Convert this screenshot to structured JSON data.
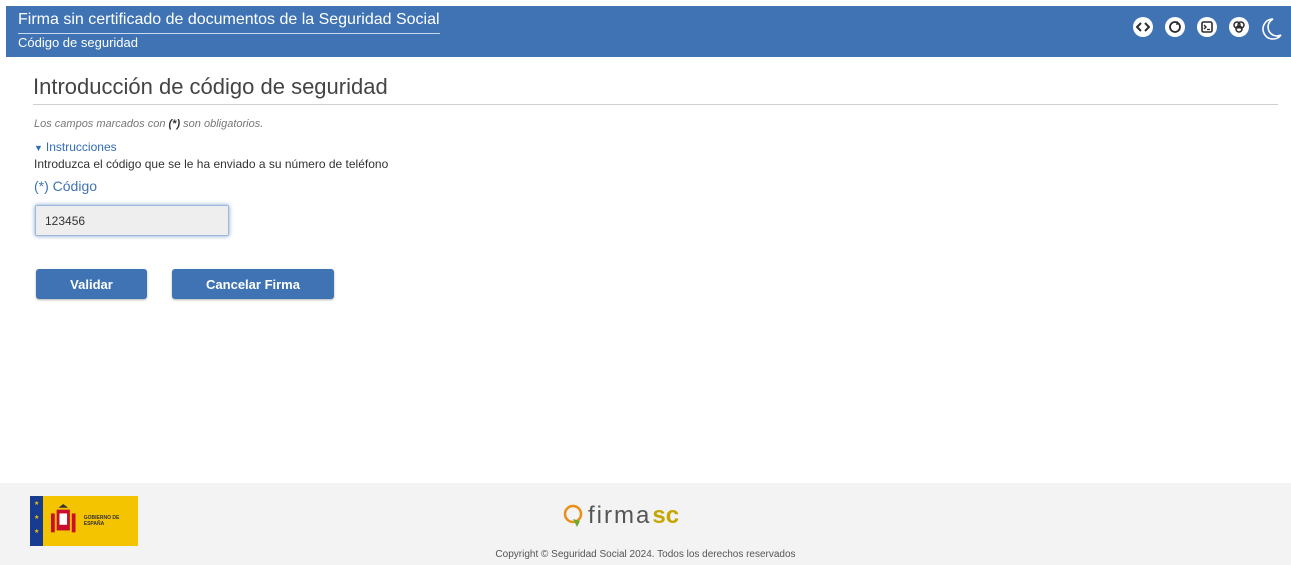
{
  "header": {
    "app_title": "Firma sin certificado de documentos de la Seguridad Social",
    "page_subtitle": "Código de seguridad",
    "icons": [
      "code-icon",
      "refresh-icon",
      "terminal-icon",
      "accessibility-icon",
      "moon-icon"
    ]
  },
  "main": {
    "title": "Introducción de código de seguridad",
    "required_note_prefix": "Los campos marcados con ",
    "required_note_marker": "(*)",
    "required_note_suffix": " son obligatorios.",
    "instructions_toggle": "Instrucciones",
    "instructions_text": "Introduzca el código que se le ha enviado a su número de teléfono",
    "code_label": "(*) Código",
    "code_value": "123456"
  },
  "buttons": {
    "validar": "Validar",
    "cancelar": "Cancelar Firma"
  },
  "footer": {
    "gov_logo_text": "GOBIERNO DE ESPAÑA",
    "firma_word": "firma",
    "firma_suffix": "sc",
    "copyright": "Copyright © Seguridad Social 2024. Todos los derechos reservados"
  },
  "colors": {
    "brand_blue": "#3f73b3",
    "footer_bg": "#f3f3f3",
    "gov_yellow": "#f5c400",
    "firma_green": "#6aaa2c"
  }
}
